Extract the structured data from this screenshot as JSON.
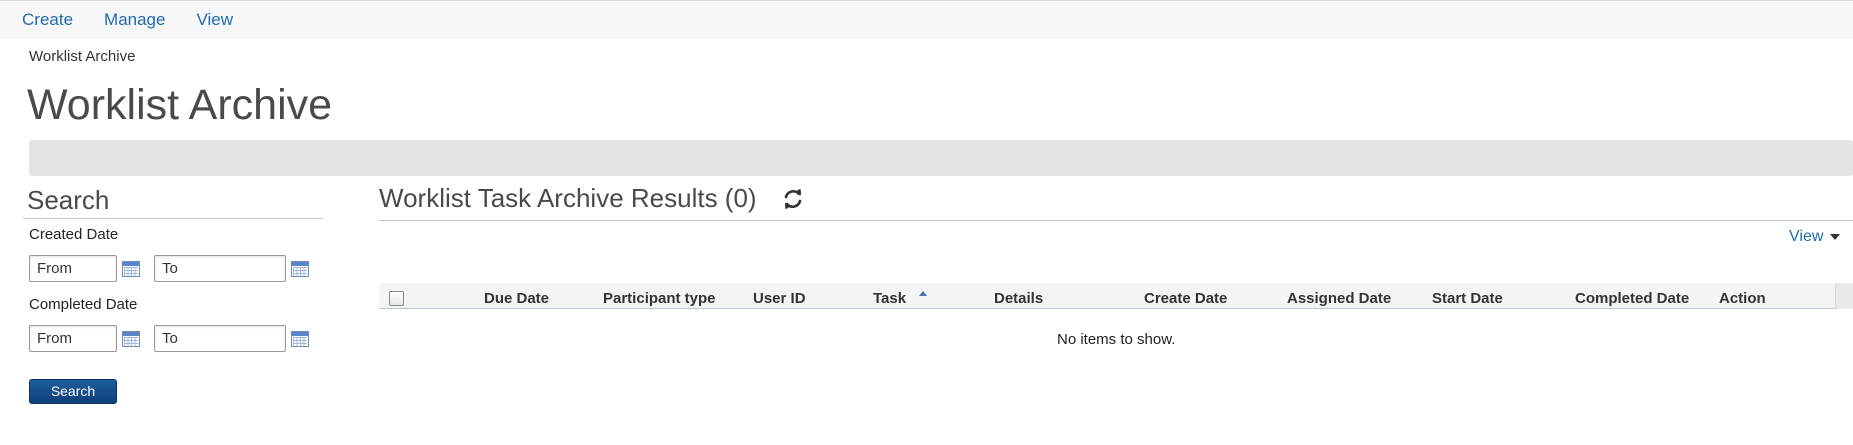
{
  "nav": {
    "items": [
      "Create",
      "Manage",
      "View"
    ]
  },
  "breadcrumb": "Worklist Archive",
  "page_title": "Worklist Archive",
  "search": {
    "title": "Search",
    "created_label": "Created Date",
    "completed_label": "Completed Date",
    "from_placeholder": "From",
    "to_placeholder": "To",
    "button_label": "Search"
  },
  "results": {
    "title": "Worklist Task Archive Results (0)",
    "view_label": "View",
    "columns": [
      "Due Date",
      "Participant type",
      "User ID",
      "Task",
      "Details",
      "Create Date",
      "Assigned Date",
      "Start Date",
      "Completed Date",
      "Action"
    ],
    "empty_message": "No items to show."
  },
  "icons": {
    "refresh": "refresh-icon",
    "calendar": "calendar-icon",
    "sort": "sort-ascending-icon",
    "caret": "caret-down-icon"
  },
  "colors": {
    "link": "#1f6ab0",
    "button": "#0e3f78",
    "bar": "#e4e4e4"
  }
}
